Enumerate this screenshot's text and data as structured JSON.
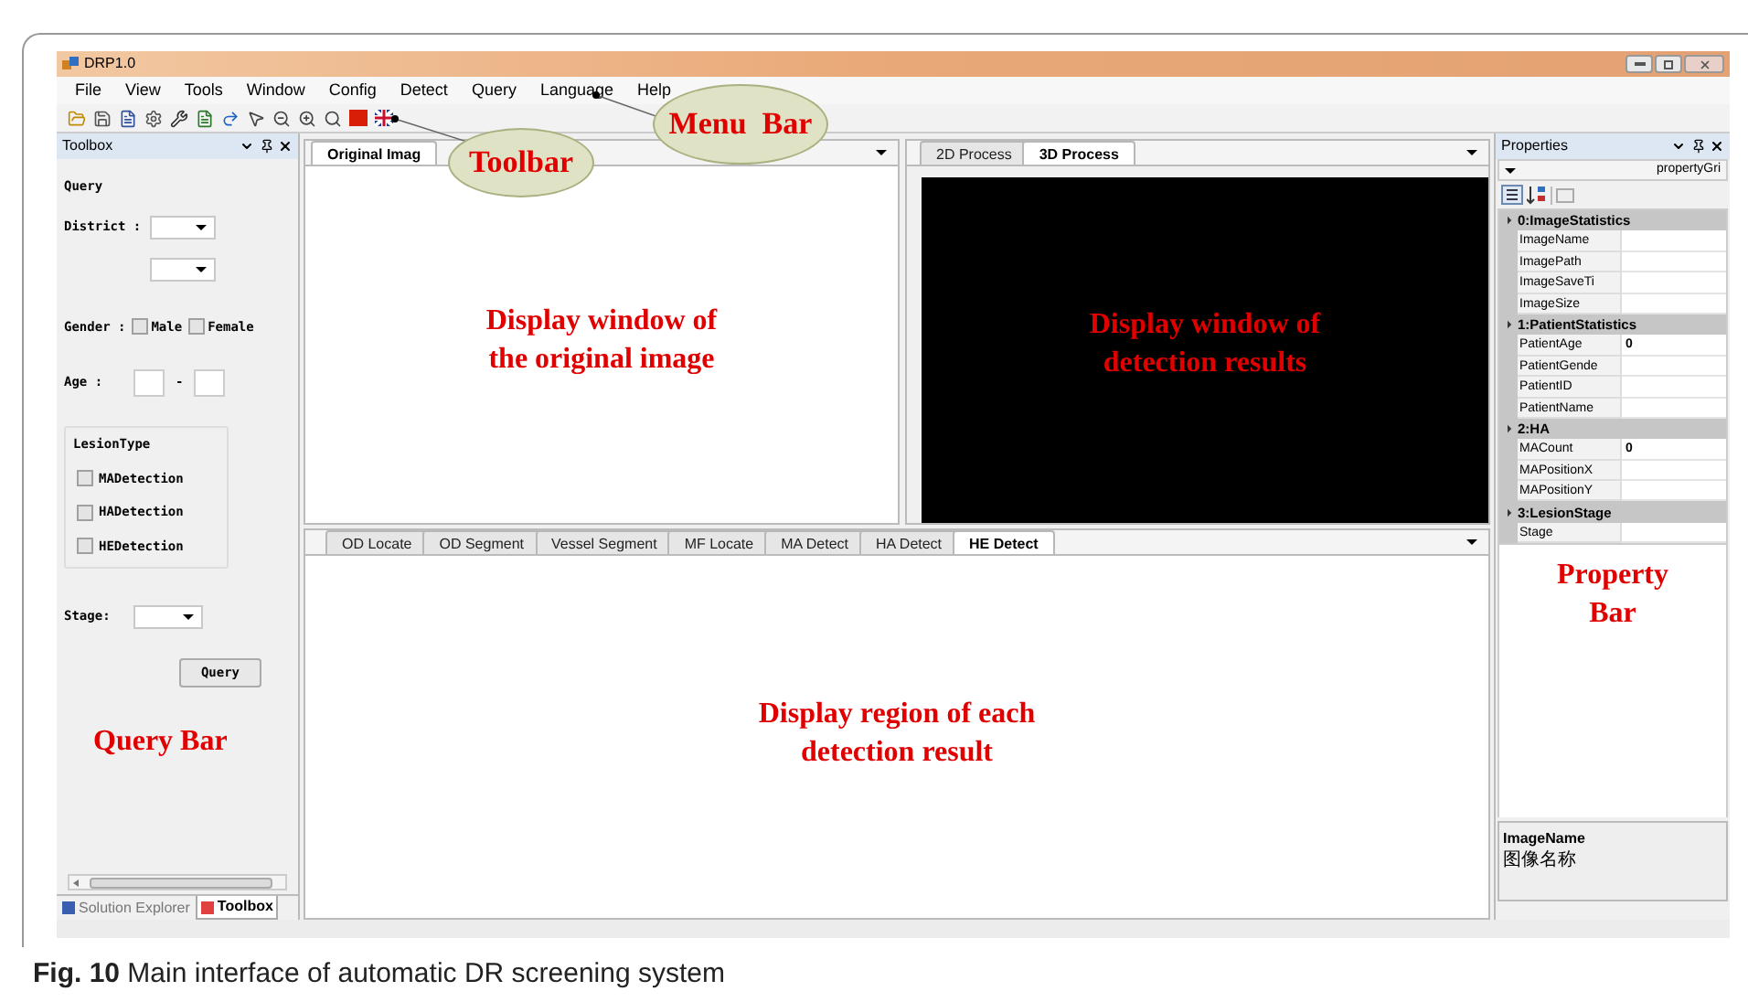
{
  "window": {
    "title": "DRP1.0"
  },
  "menu": [
    "File",
    "View",
    "Tools",
    "Window",
    "Config",
    "Detect",
    "Query",
    "Language",
    "Help"
  ],
  "toolbox": {
    "title": "Toolbox",
    "group": "Query",
    "district_label": "District :",
    "gender_label": "Gender :",
    "gender_options": [
      {
        "label": "Male",
        "checked": false
      },
      {
        "label": "Female",
        "checked": false
      }
    ],
    "age_label": "Age :",
    "age_separator": "-",
    "lesion": {
      "title": "LesionType",
      "options": [
        {
          "label": "MADetection",
          "checked": false
        },
        {
          "label": "HADetection",
          "checked": false
        },
        {
          "label": "HEDetection",
          "checked": false
        }
      ]
    },
    "stage_label": "Stage:",
    "query_button": "Query",
    "annotation": "Query Bar",
    "tabs": [
      {
        "label": "Solution Explorer",
        "selected": false
      },
      {
        "label": "Toolbox",
        "selected": true
      }
    ]
  },
  "image_panel": {
    "tabs": [
      {
        "label": "Original Imag",
        "selected": true
      }
    ],
    "annotation_lines": [
      "Display window of",
      "the original image"
    ]
  },
  "process_panel": {
    "tabs": [
      {
        "label": "2D Process",
        "selected": false
      },
      {
        "label": "3D Process",
        "selected": true
      }
    ],
    "annotation_lines": [
      "Display window of",
      "detection results"
    ]
  },
  "detect_panel": {
    "tabs": [
      {
        "label": "OD Locate",
        "selected": false
      },
      {
        "label": "OD Segment",
        "selected": false
      },
      {
        "label": "Vessel Segment",
        "selected": false
      },
      {
        "label": "MF Locate",
        "selected": false
      },
      {
        "label": "MA Detect",
        "selected": false
      },
      {
        "label": "HA Detect",
        "selected": false
      },
      {
        "label": "HE Detect",
        "selected": true
      }
    ],
    "annotation_lines": [
      "Display region of each",
      "detection result"
    ]
  },
  "properties": {
    "title": "Properties",
    "selector": "propertyGri",
    "categories": [
      {
        "name": "0:ImageStatistics",
        "expanded": true,
        "rows": [
          {
            "name": "ImageName",
            "value": ""
          },
          {
            "name": "ImagePath",
            "value": ""
          },
          {
            "name": "ImageSaveTi",
            "value": ""
          },
          {
            "name": "ImageSize",
            "value": ""
          }
        ]
      },
      {
        "name": "1:PatientStatistics",
        "expanded": true,
        "rows": [
          {
            "name": "PatientAge",
            "value": "0"
          },
          {
            "name": "PatientGende",
            "value": ""
          },
          {
            "name": "PatientID",
            "value": ""
          },
          {
            "name": "PatientName",
            "value": ""
          }
        ]
      },
      {
        "name": "2:HA",
        "expanded": true,
        "rows": [
          {
            "name": "MACount",
            "value": "0"
          },
          {
            "name": "MAPositionX",
            "value": ""
          },
          {
            "name": "MAPositionY",
            "value": ""
          }
        ]
      },
      {
        "name": "3:LesionStage",
        "expanded": true,
        "rows": [
          {
            "name": "Stage",
            "value": ""
          }
        ]
      }
    ],
    "annotation_lines": [
      "Property",
      "Bar"
    ],
    "description": {
      "title": "ImageName",
      "text": "图像名称"
    }
  },
  "callouts": [
    {
      "text": "Toolbar"
    },
    {
      "text": "Menu  Bar"
    }
  ],
  "caption": "**Fig. 10**  Main interface of automatic DR screening system"
}
